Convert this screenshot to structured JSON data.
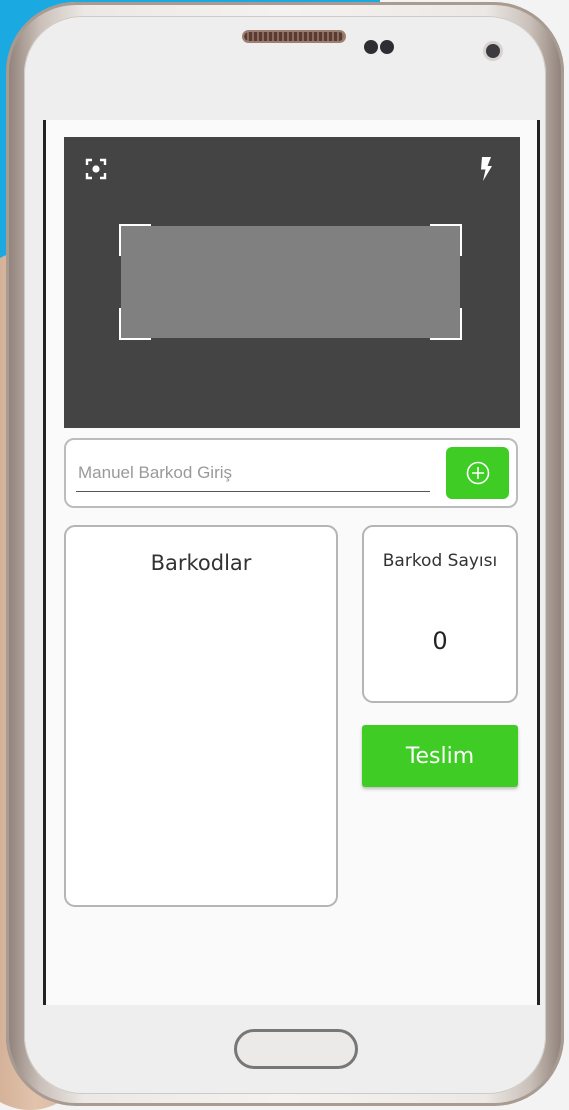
{
  "colors": {
    "scanner_background": "#444444",
    "focus_area": "#808080",
    "accent_green": "#3ecc25",
    "screen_background": "#fafafa"
  },
  "scanner": {
    "focus_icon": "focus-target-icon",
    "flash_icon": "flash-bolt-icon"
  },
  "entry": {
    "placeholder": "Manuel Barkod Giriş",
    "value": "",
    "add_icon": "plus-circle-icon"
  },
  "barcodes_panel": {
    "title": "Barkodlar",
    "items": []
  },
  "count_panel": {
    "label": "Barkod Sayısı",
    "value": "0"
  },
  "deliver_button": {
    "label": "Teslim"
  }
}
